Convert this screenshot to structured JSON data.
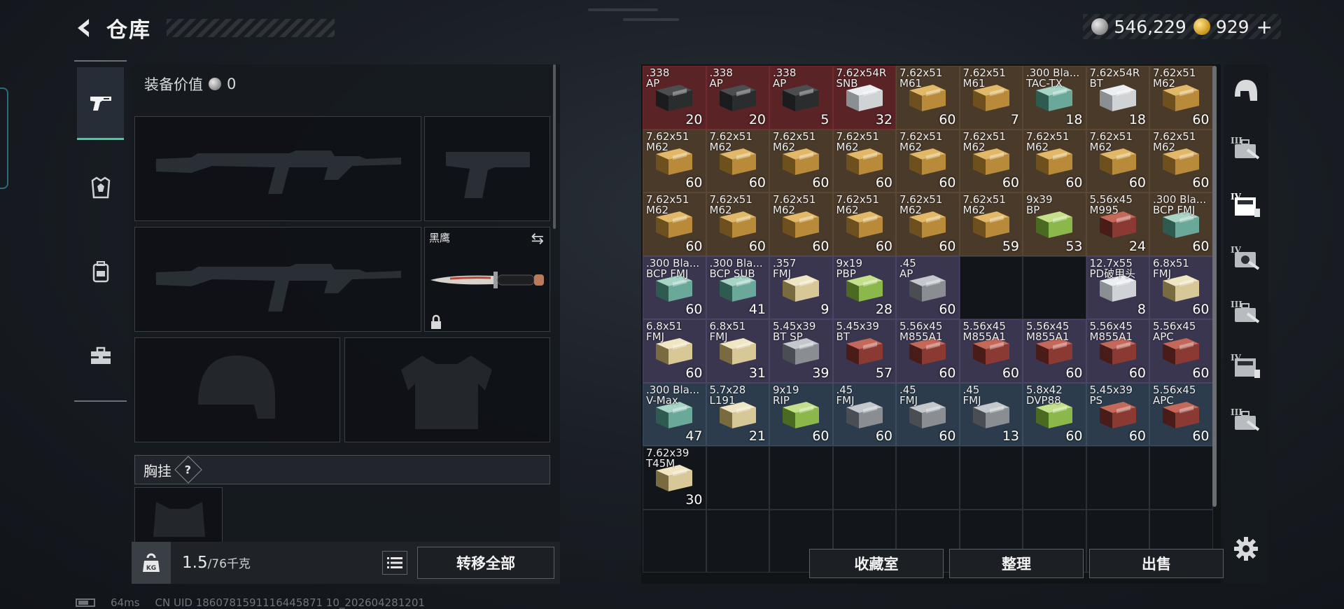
{
  "header": {
    "title": "仓库",
    "back_icon": "chevron-left-icon"
  },
  "currency": {
    "silver_value": "546,229",
    "gold_value": "929",
    "gold_plus": "+"
  },
  "left_tabs": [
    {
      "id": "weapons",
      "icon": "pistol-icon",
      "active": true
    },
    {
      "id": "armor",
      "icon": "vest-icon",
      "active": false
    },
    {
      "id": "backpack",
      "icon": "backpack-icon",
      "active": false
    },
    {
      "id": "tools",
      "icon": "toolbox-icon",
      "active": false
    }
  ],
  "equipment": {
    "value_label": "装备价值",
    "value_amount": "0",
    "melee_label": "黑鹰",
    "chest_rig_label": "胸挂",
    "chest_rig_help": "?",
    "weight_current": "1.5",
    "weight_max": "/76千克",
    "kg_label": "KG",
    "move_all_label": "转移全部"
  },
  "storage": {
    "items": [
      {
        "name": ".338\nAP",
        "qty": "20",
        "color": "red",
        "art": "ammo-can-dark"
      },
      {
        "name": ".338\nAP",
        "qty": "20",
        "color": "red",
        "art": "ammo-can-dark"
      },
      {
        "name": ".338\nAP",
        "qty": "5",
        "color": "red",
        "art": "ammo-can-dark"
      },
      {
        "name": "7.62x54R\nSNB",
        "qty": "32",
        "color": "red",
        "art": "box-white"
      },
      {
        "name": "7.62x51\nM61",
        "qty": "60",
        "color": "brown",
        "art": "box-gold"
      },
      {
        "name": "7.62x51\nM61",
        "qty": "7",
        "color": "brown",
        "art": "box-gold"
      },
      {
        "name": ".300 Bla...\nTAC-TX",
        "qty": "18",
        "color": "brown",
        "art": "box-teal"
      },
      {
        "name": "7.62x54R\nBT",
        "qty": "18",
        "color": "brown",
        "art": "box-white"
      },
      {
        "name": "7.62x51\nM62",
        "qty": "60",
        "color": "brown",
        "art": "box-gold"
      },
      {
        "name": "7.62x51\nM62",
        "qty": "60",
        "color": "brown",
        "art": "box-gold"
      },
      {
        "name": "7.62x51\nM62",
        "qty": "60",
        "color": "brown",
        "art": "box-gold"
      },
      {
        "name": "7.62x51\nM62",
        "qty": "60",
        "color": "brown",
        "art": "box-gold"
      },
      {
        "name": "7.62x51\nM62",
        "qty": "60",
        "color": "brown",
        "art": "box-gold"
      },
      {
        "name": "7.62x51\nM62",
        "qty": "60",
        "color": "brown",
        "art": "box-gold"
      },
      {
        "name": "7.62x51\nM62",
        "qty": "60",
        "color": "brown",
        "art": "box-gold"
      },
      {
        "name": "7.62x51\nM62",
        "qty": "60",
        "color": "brown",
        "art": "box-gold"
      },
      {
        "name": "7.62x51\nM62",
        "qty": "60",
        "color": "brown",
        "art": "box-gold"
      },
      {
        "name": "7.62x51\nM62",
        "qty": "60",
        "color": "brown",
        "art": "box-gold"
      },
      {
        "name": "7.62x51\nM62",
        "qty": "60",
        "color": "brown",
        "art": "box-gold"
      },
      {
        "name": "7.62x51\nM62",
        "qty": "60",
        "color": "brown",
        "art": "box-gold"
      },
      {
        "name": "7.62x51\nM62",
        "qty": "60",
        "color": "brown",
        "art": "box-gold"
      },
      {
        "name": "7.62x51\nM62",
        "qty": "60",
        "color": "brown",
        "art": "box-gold"
      },
      {
        "name": "7.62x51\nM62",
        "qty": "60",
        "color": "brown",
        "art": "box-gold"
      },
      {
        "name": "7.62x51\nM62",
        "qty": "59",
        "color": "brown",
        "art": "box-gold"
      },
      {
        "name": "9x39\nBP",
        "qty": "53",
        "color": "brown",
        "art": "box-green"
      },
      {
        "name": "5.56x45\nM995",
        "qty": "24",
        "color": "brown",
        "art": "box-red"
      },
      {
        "name": ".300 Bla...\nBCP FMJ",
        "qty": "60",
        "color": "brown",
        "art": "box-teal"
      },
      {
        "name": ".300 Bla...\nBCP FMJ",
        "qty": "60",
        "color": "purple",
        "art": "box-teal"
      },
      {
        "name": ".300 Bla...\nBCP SUB",
        "qty": "41",
        "color": "purple",
        "art": "box-teal"
      },
      {
        "name": ".357\nFMJ",
        "qty": "9",
        "color": "purple",
        "art": "box-cream"
      },
      {
        "name": "9x19\nPBP",
        "qty": "28",
        "color": "purple",
        "art": "box-green"
      },
      {
        "name": ".45\nAP",
        "qty": "60",
        "color": "purple",
        "art": "box-grey"
      },
      {
        "name": "",
        "qty": "",
        "color": "empty",
        "art": ""
      },
      {
        "name": "",
        "qty": "",
        "color": "empty",
        "art": ""
      },
      {
        "name": "12.7x55\nPD破甲头",
        "qty": "8",
        "color": "purple",
        "art": "box-white"
      },
      {
        "name": "6.8x51\nFMJ",
        "qty": "60",
        "color": "purple",
        "art": "box-cream"
      },
      {
        "name": "6.8x51\nFMJ",
        "qty": "60",
        "color": "purple",
        "art": "box-cream"
      },
      {
        "name": "6.8x51\nFMJ",
        "qty": "31",
        "color": "purple",
        "art": "box-cream"
      },
      {
        "name": "5.45x39\nBT SP",
        "qty": "39",
        "color": "purple",
        "art": "box-grey"
      },
      {
        "name": "5.45x39\nBT",
        "qty": "57",
        "color": "purple",
        "art": "box-red"
      },
      {
        "name": "5.56x45\nM855A1",
        "qty": "60",
        "color": "purple",
        "art": "box-red"
      },
      {
        "name": "5.56x45\nM855A1",
        "qty": "60",
        "color": "purple",
        "art": "box-red"
      },
      {
        "name": "5.56x45\nM855A1",
        "qty": "60",
        "color": "purple",
        "art": "box-red"
      },
      {
        "name": "5.56x45\nM855A1",
        "qty": "60",
        "color": "purple",
        "art": "box-red"
      },
      {
        "name": "5.56x45\nAPC",
        "qty": "60",
        "color": "purple",
        "art": "box-red"
      },
      {
        "name": ".300 Bla...\nV-Max",
        "qty": "47",
        "color": "blue",
        "art": "box-teal"
      },
      {
        "name": "5.7x28\nL191",
        "qty": "21",
        "color": "blue",
        "art": "box-cream"
      },
      {
        "name": "9x19\nRIP",
        "qty": "60",
        "color": "blue",
        "art": "box-green"
      },
      {
        "name": ".45\nFMJ",
        "qty": "60",
        "color": "blue",
        "art": "box-grey"
      },
      {
        "name": ".45\nFMJ",
        "qty": "60",
        "color": "blue",
        "art": "box-grey"
      },
      {
        "name": ".45\nFMJ",
        "qty": "13",
        "color": "blue",
        "art": "box-grey"
      },
      {
        "name": "5.8x42\nDVP88",
        "qty": "60",
        "color": "blue",
        "art": "box-green"
      },
      {
        "name": "5.45x39\nPS",
        "qty": "60",
        "color": "blue",
        "art": "box-red"
      },
      {
        "name": "5.56x45\nAPC",
        "qty": "60",
        "color": "blue",
        "art": "box-red"
      },
      {
        "name": "7.62x39\nT45M",
        "qty": "30",
        "color": "default",
        "art": "box-cream"
      }
    ],
    "empty_cells_after": 17,
    "buttons": {
      "collection": "收藏室",
      "sort": "整理",
      "sell": "出售"
    }
  },
  "right_tabs": [
    {
      "id": "all",
      "roman": "",
      "icon": "helmet-icon",
      "active": false
    },
    {
      "id": "t3-weapon",
      "roman": "III",
      "icon": "weapon-case-icon",
      "active": false
    },
    {
      "id": "t4-ammo",
      "roman": "IV",
      "icon": "ammo-box-icon",
      "active": true
    },
    {
      "id": "t4-case",
      "roman": "IV",
      "icon": "gear-case-icon",
      "active": false
    },
    {
      "id": "t3-misc",
      "roman": "III",
      "icon": "weapon-case-icon",
      "active": false
    },
    {
      "id": "t4-misc",
      "roman": "IV",
      "icon": "ammo-box-icon",
      "active": false
    },
    {
      "id": "t3-other",
      "roman": "III",
      "icon": "weapon-case-icon",
      "active": false
    }
  ],
  "status_bar": {
    "ping": "64ms",
    "uid": "CN UID 1860781591116445871 10_202604281201"
  },
  "colors": {
    "accent": "#3fd0a0",
    "rarity_red": "#5a2326",
    "rarity_gold": "#4a3a2a",
    "rarity_purple": "#3a3650",
    "rarity_blue": "#2c3c4c"
  }
}
